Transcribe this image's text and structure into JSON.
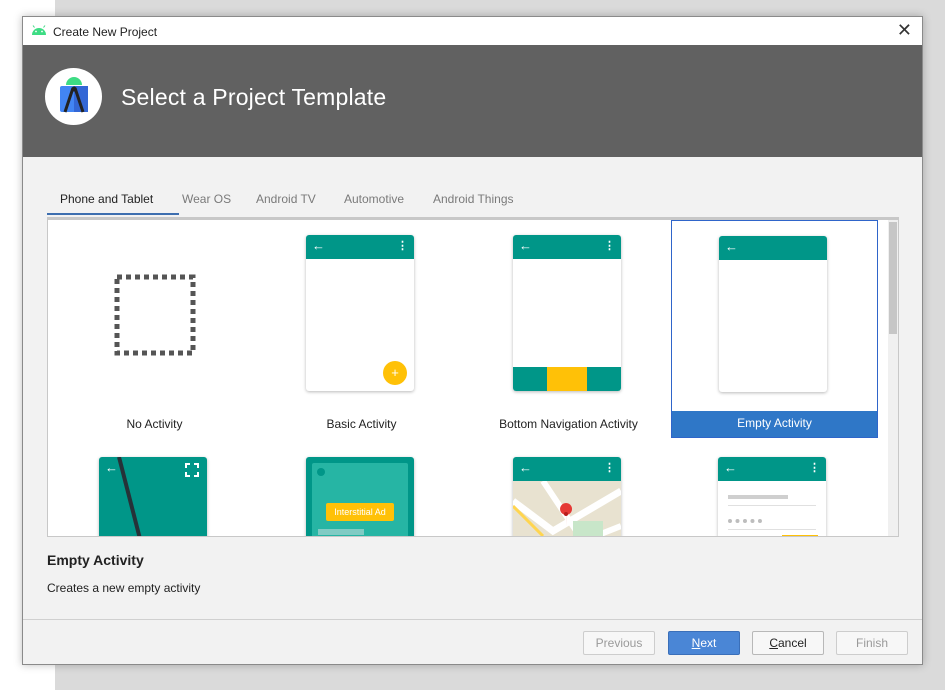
{
  "window": {
    "title": "Create New Project",
    "close_glyph": "✕"
  },
  "header": {
    "title": "Select a Project Template"
  },
  "tabs": [
    {
      "label": "Phone and Tablet",
      "active": true
    },
    {
      "label": "Wear OS"
    },
    {
      "label": "Android TV"
    },
    {
      "label": "Automotive"
    },
    {
      "label": "Android Things"
    }
  ],
  "templates": [
    {
      "label": "No Activity"
    },
    {
      "label": "Basic Activity"
    },
    {
      "label": "Bottom Navigation Activity"
    },
    {
      "label": "Empty Activity",
      "selected": true
    }
  ],
  "preview_text": {
    "interstitial": "Interstitial Ad"
  },
  "icons": {
    "back_arrow": "←",
    "menu_dots": "⋮",
    "fab_plus": "+"
  },
  "details": {
    "title": "Empty Activity",
    "description": "Creates a new empty activity"
  },
  "buttons": {
    "previous": "Previous",
    "next_mnemonic": "N",
    "next_rest": "ext",
    "cancel_mnemonic": "C",
    "cancel_rest": "ancel",
    "finish": "Finish"
  },
  "colors": {
    "accent": "#2f77c7",
    "teal": "#009688",
    "amber": "#ffc107",
    "header_bg": "#616161"
  }
}
